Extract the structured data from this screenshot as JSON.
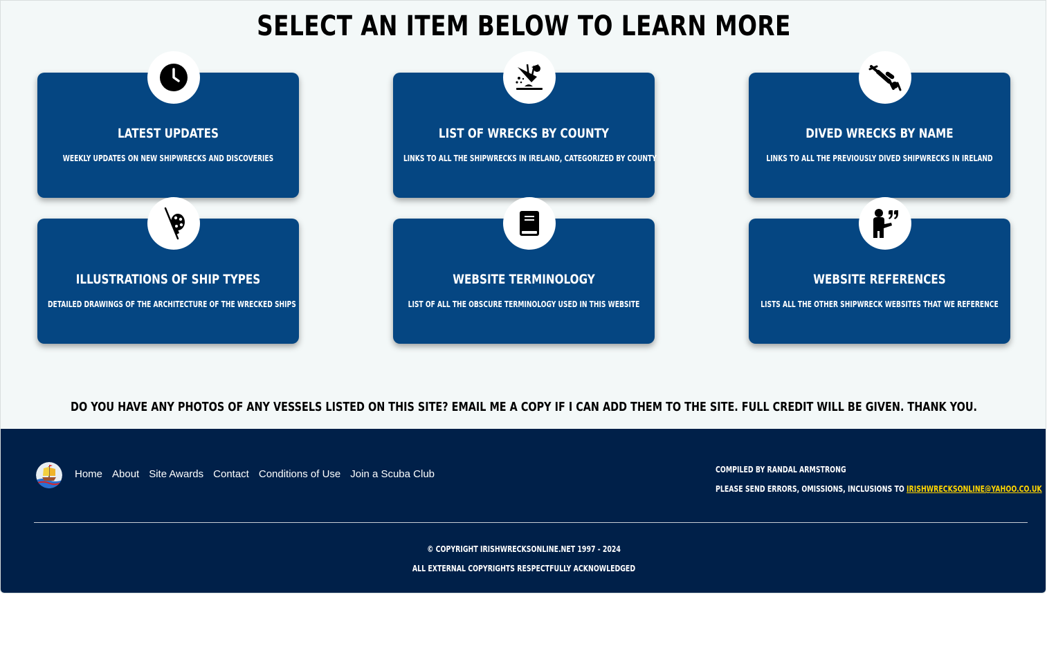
{
  "heading": "Select an item below to learn more",
  "cards": [
    {
      "title": "Latest Updates",
      "description": "Weekly updates on new shipwrecks and discoveries",
      "icon": "clock-icon"
    },
    {
      "title": "List of Wrecks by County",
      "description": "Links to all the shipwrecks in Ireland, categorized by county",
      "icon": "sinking-ship-icon"
    },
    {
      "title": "Dived Wrecks by Name",
      "description": "Links to all the previously dived shipwrecks in Ireland",
      "icon": "scuba-diver-icon"
    },
    {
      "title": "Illustrations of Ship Types",
      "description": "Detailed drawings of the architecture of the wrecked ships",
      "icon": "palette-brush-icon"
    },
    {
      "title": "Website Terminology",
      "description": "List of all the obscure terminology used in this website",
      "icon": "book-icon"
    },
    {
      "title": "Website References",
      "description": "Lists all the other shipwreck websites that we reference",
      "icon": "person-quote-icon"
    }
  ],
  "photo_notice": "Do you have any photos of any vessels listed on this site? Email me a copy if I can add them to the site. Full credit will be given. Thank you.",
  "footer": {
    "nav": [
      "Home",
      "About",
      "Site Awards",
      "Contact",
      "Conditions of Use",
      "Join a Scuba Club"
    ],
    "compiled_by": "Compiled by Randal Armstrong",
    "send_errors": "Please send errors, omissions, inclusions to ",
    "email": "irishwrecksonline@yahoo.co.uk",
    "copyright": "© Copyright irishwrecksonline.net 1997 - 2024",
    "acknowledged": "All external copyrights respectfully acknowledged"
  },
  "colors": {
    "card_bg": "#054682",
    "footer_bg": "#002049",
    "page_bg": "#f3f8f8",
    "email_link": "#ffd400"
  }
}
